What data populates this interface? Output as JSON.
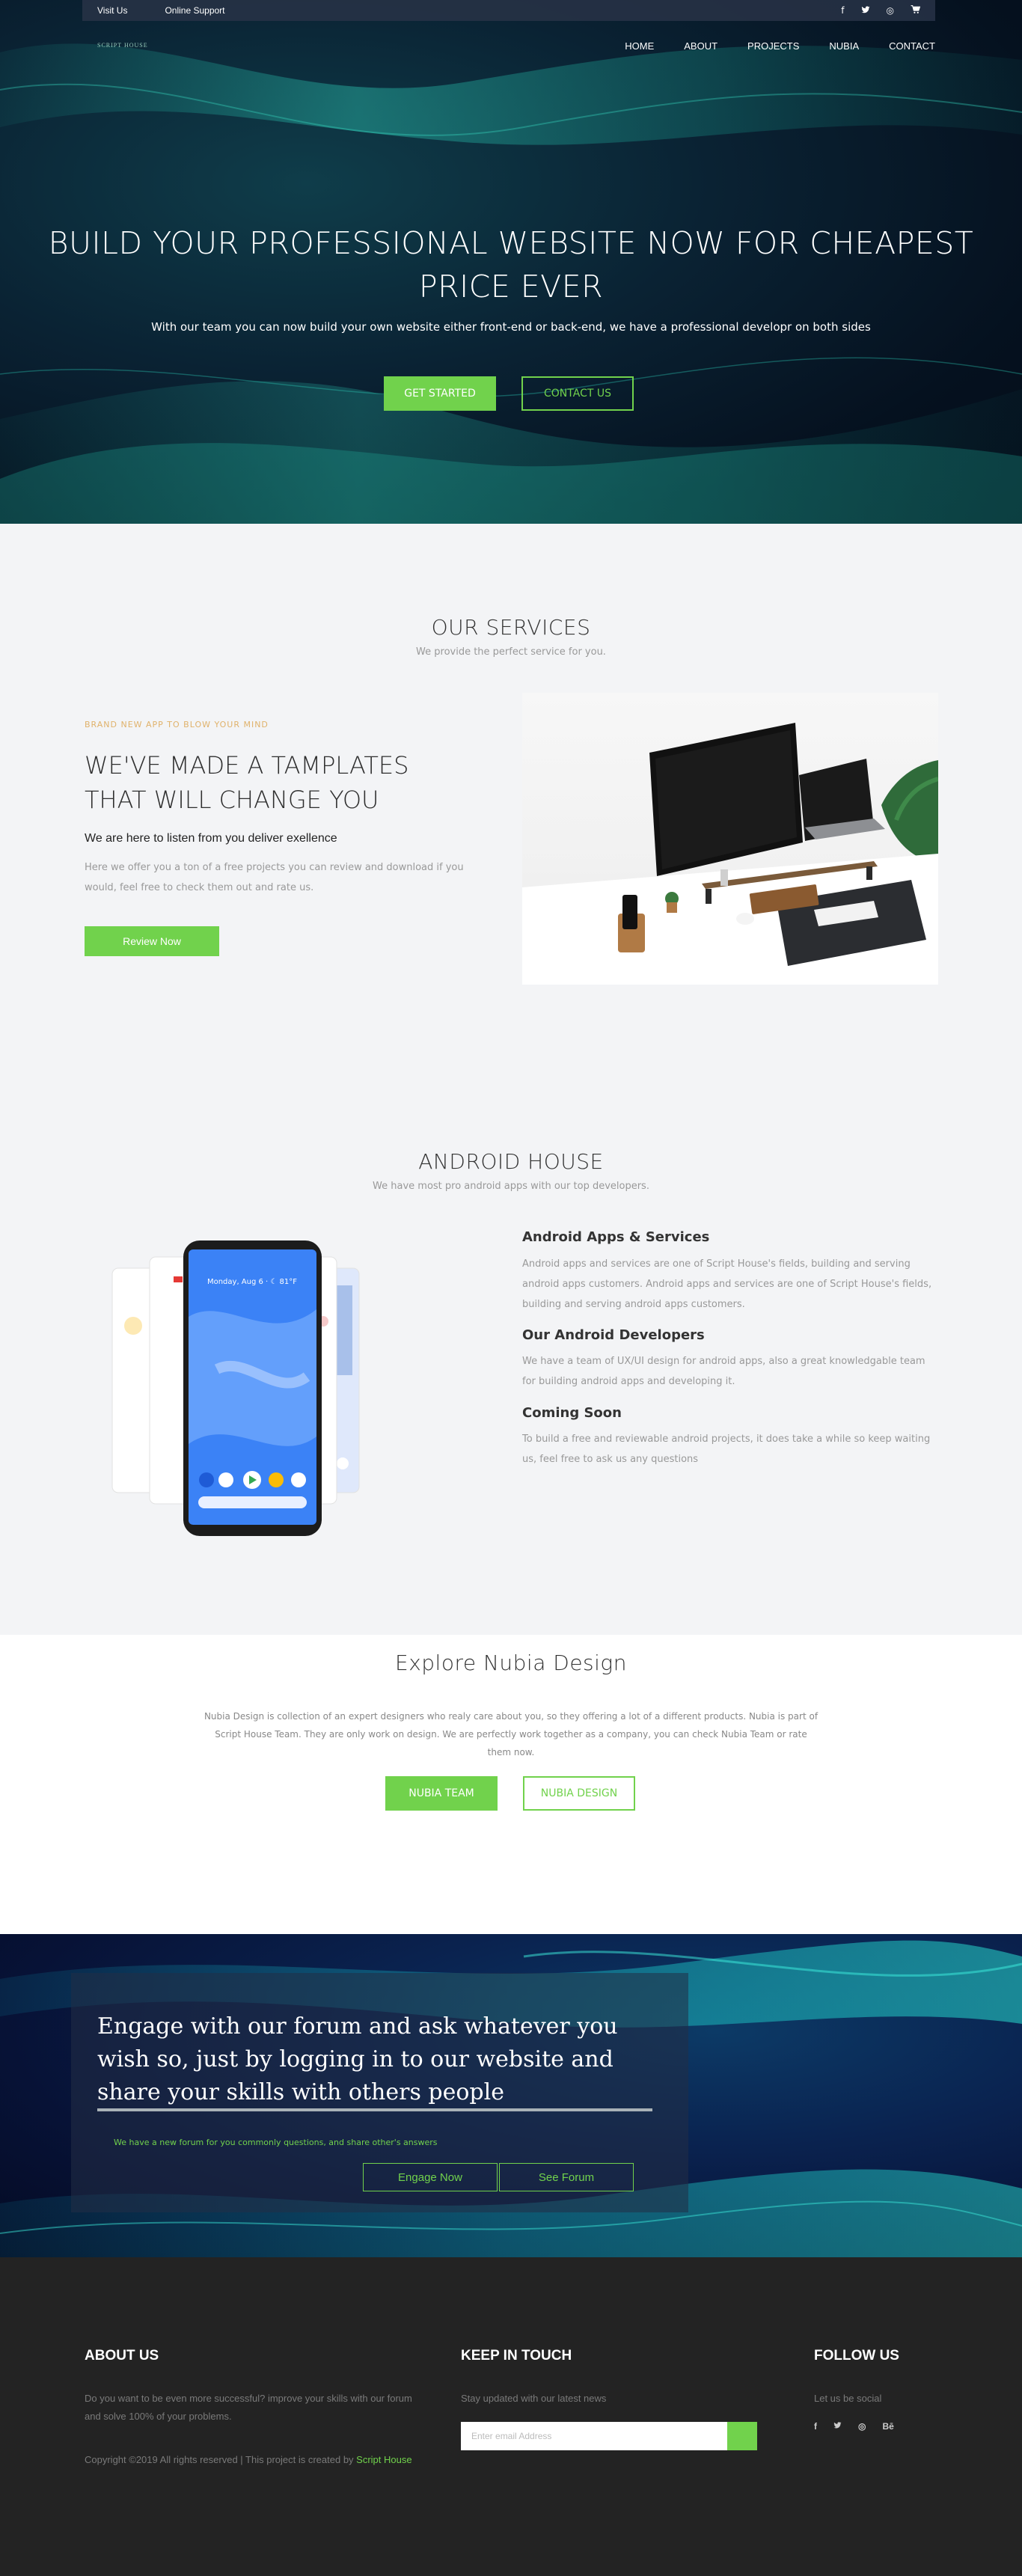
{
  "topbar": {
    "links": [
      "Visit Us",
      "Online Support"
    ],
    "social": [
      "f",
      "t",
      "◎",
      "cart"
    ]
  },
  "brand": "SCRIPT HOUSE",
  "nav": [
    "HOME",
    "ABOUT",
    "PROJECTS",
    "NUBIA",
    "CONTACT"
  ],
  "hero": {
    "title_line1": "BUILD YOUR PROFESSIONAL WEBSITE NOW FOR CHEAPEST",
    "title_line2": "PRICE EVER",
    "subtitle": "With our team you can now build your own website either front-end or back-end, we have a professional developr on both sides",
    "primary_button": "GET STARTED",
    "secondary_button": "CONTACT US"
  },
  "services": {
    "title": "OUR SERVICES",
    "subtitle": "We provide the perfect service for you.",
    "kicker": "BRAND NEW APP TO BLOW YOUR MIND",
    "heading_line1": "WE'VE MADE A TAMPLATES",
    "heading_line2": "THAT WILL CHANGE YOU",
    "lead": "We are here to listen from you deliver exellence",
    "body": "Here we offer you a ton of a free projects you can review and download if you would, feel free to check them out and rate us.",
    "button": "Review Now"
  },
  "android": {
    "title": "ANDROID HOUSE",
    "subtitle": "We have most pro android apps with our top developers.",
    "items": [
      {
        "title": "Android Apps & Services",
        "body": "Android apps and services are one of Script House's fields, building and serving android apps customers. Android apps and services are one of Script House's fields, building and serving android apps customers."
      },
      {
        "title": "Our Android Developers",
        "body": "We have a team of UX/UI design for android apps, also a great knowledgable team for building android apps and developing it."
      },
      {
        "title": "Coming Soon",
        "body": "To build a free and reviewable android projects, it does take a while so keep waiting us, feel free to ask us any questions"
      }
    ],
    "phone_date": "Monday, Aug 6 · ☾ 81°F"
  },
  "nubia": {
    "title": "Explore Nubia Design",
    "body": "Nubia Design is collection of an expert designers who realy care about you, so they offering a lot of a different products. Nubia is part of Script House Team. They are only work on design. We are perfectly work together as a company, you can check Nubia Team or rate them now.",
    "primary_button": "NUBIA TEAM",
    "secondary_button": "NUBIA DESIGN"
  },
  "forum": {
    "heading": "Engage with our forum and ask whatever you wish so, just by logging in to our website and share your skills with others people",
    "note": "We have a new forum for you commonly questions, and share other's answers",
    "button_engage": "Engage Now",
    "button_see": "See Forum"
  },
  "footer": {
    "about_title": "ABOUT US",
    "about_text": "Do you want to be even more successful? improve your skills with our forum and solve 100% of your problems.",
    "copyright_prefix": "Copyright ©2019 All rights reserved | This project is created by ",
    "copyright_link": "Script House",
    "keep_title": "KEEP IN TOUCH",
    "keep_text": "Stay updated with our latest news",
    "email_placeholder": "Enter email Address",
    "follow_title": "FOLLOW US",
    "follow_text": "Let us be social",
    "social": [
      "f",
      "t",
      "◎",
      "Bē"
    ]
  },
  "colors": {
    "accent": "#71d24c",
    "kicker": "#e0b26b",
    "footer_bg": "#232323"
  }
}
